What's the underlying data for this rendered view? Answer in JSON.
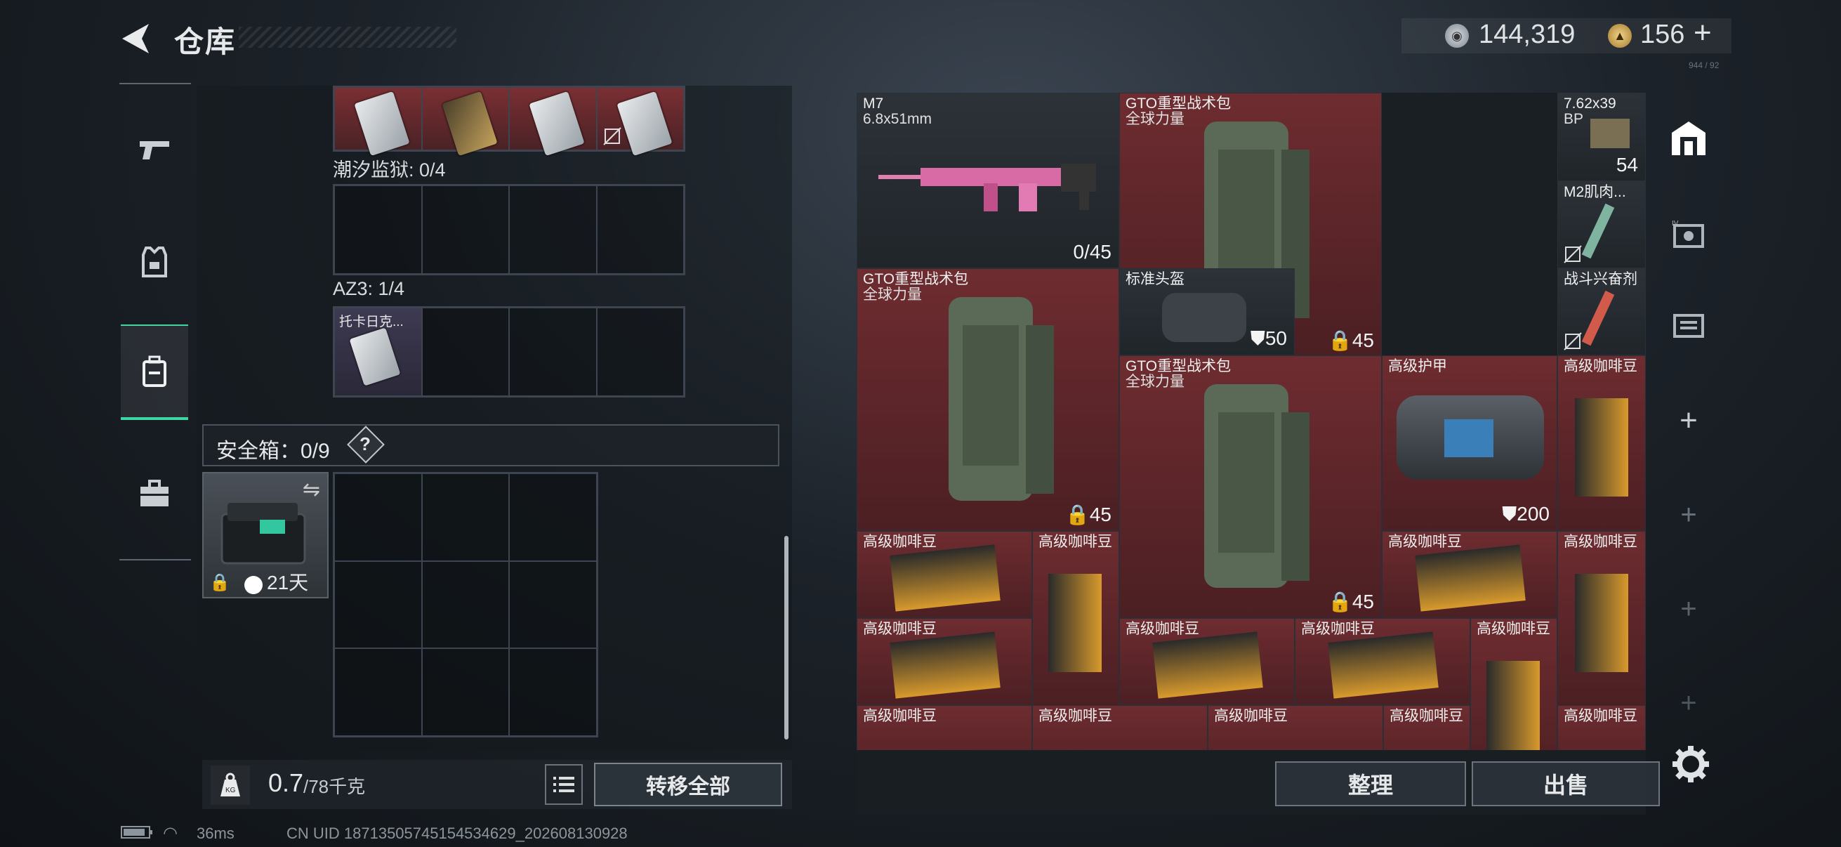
{
  "header": {
    "title": "仓库",
    "currency_silver": "144,319",
    "currency_gold": "156",
    "add": "+",
    "tiny_text": "944 / 92"
  },
  "left_nav": {
    "items": [
      "weapon",
      "armor",
      "backpack",
      "briefcase"
    ],
    "active": "backpack"
  },
  "left_panel": {
    "section1_label": "潮汐监狱: 0/4",
    "section2_label": "AZ3: 1/4",
    "az3_item": "托卡日克...",
    "safebox_label": "安全箱：0/9",
    "safebox_help": "?",
    "safebox_timer": "21天"
  },
  "weight": {
    "value": "0.7",
    "max": "/78千克"
  },
  "buttons": {
    "transfer_all": "转移全部",
    "sort": "整理",
    "sell": "出售"
  },
  "warehouse": {
    "m7": {
      "name": "M7",
      "sub": "6.8x51mm",
      "value": "0/45"
    },
    "ammo": {
      "name": "7.62x39",
      "sub": "BP",
      "value": "54"
    },
    "bag1": {
      "name": "GTO重型战术包",
      "sub": "全球力量",
      "value": "45"
    },
    "bag2": {
      "name": "GTO重型战术包",
      "sub": "全球力量",
      "value": "45"
    },
    "bag3": {
      "name": "GTO重型战术包",
      "sub": "全球力量",
      "value": "45"
    },
    "m2": {
      "name": "M2肌肉..."
    },
    "helmet": {
      "name": "标准头盔",
      "value": "50"
    },
    "stim": {
      "name": "战斗兴奋剂"
    },
    "armor": {
      "name": "高级护甲",
      "value": "200"
    },
    "coffee": "高级咖啡豆"
  },
  "status": {
    "ping": "36ms",
    "uid": "CN UID 18713505745154534629_202608130928"
  },
  "colors": {
    "accent": "#3fd6a2",
    "slot_red": "#6e2c30"
  }
}
